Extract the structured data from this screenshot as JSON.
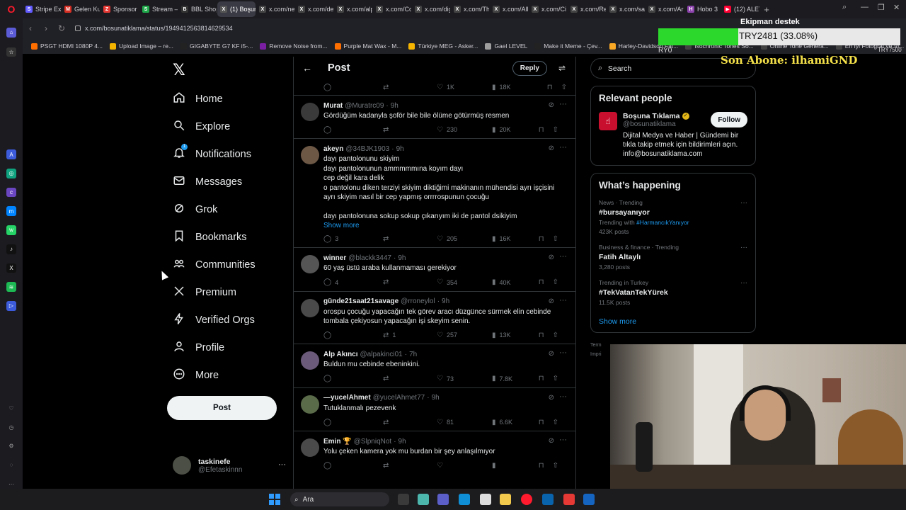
{
  "browser": {
    "tabs": [
      {
        "label": "Stripe Exp",
        "color": "#635bff",
        "glyph": "S"
      },
      {
        "label": "Gelen Kut",
        "color": "#d93025",
        "glyph": "M"
      },
      {
        "label": "Sponsor",
        "color": "#e53935",
        "glyph": "Z"
      },
      {
        "label": "Stream –",
        "color": "#20a94a",
        "glyph": "S"
      },
      {
        "label": "BBL Shop",
        "color": "#333333",
        "glyph": "B"
      },
      {
        "label": "(1) Boşuna Tıkla",
        "color": "#555555",
        "glyph": "X",
        "active": true
      },
      {
        "label": "x.com/ne",
        "color": "#444444",
        "glyph": "X"
      },
      {
        "label": "x.com/de",
        "color": "#444444",
        "glyph": "X"
      },
      {
        "label": "x.com/alp",
        "color": "#444444",
        "glyph": "X"
      },
      {
        "label": "x.com/Co",
        "color": "#444444",
        "glyph": "X"
      },
      {
        "label": "x.com/dig",
        "color": "#444444",
        "glyph": "X"
      },
      {
        "label": "x.com/Th",
        "color": "#444444",
        "glyph": "X"
      },
      {
        "label": "x.com/All",
        "color": "#444444",
        "glyph": "X"
      },
      {
        "label": "x.com/Ci",
        "color": "#444444",
        "glyph": "X"
      },
      {
        "label": "x.com/Re",
        "color": "#444444",
        "glyph": "X"
      },
      {
        "label": "x.com/sa",
        "color": "#444444",
        "glyph": "X"
      },
      {
        "label": "x.com/Ar",
        "color": "#444444",
        "glyph": "X"
      },
      {
        "label": "Hobo 3",
        "color": "#8e44ad",
        "glyph": "H"
      },
      {
        "label": "(12) ALET",
        "color": "#ff0033",
        "glyph": "▶"
      }
    ],
    "url": "x.com/bosunatiklama/status/1949412563814629534",
    "bookmarks": [
      {
        "label": "PSGT HDMI 1080P 4...",
        "color": "#ff6f00"
      },
      {
        "label": "Upload Image – re...",
        "color": "#f4b400"
      },
      {
        "label": "GIGABYTE G7 KF i5-...",
        "color": "#222222"
      },
      {
        "label": "Remove Noise from...",
        "color": "#7b1fa2"
      },
      {
        "label": "Purple Mat Wax - M...",
        "color": "#ff6f00"
      },
      {
        "label": "Türkiye MEG - Asker...",
        "color": "#f4b400"
      },
      {
        "label": "Gael LEVEL",
        "color": "#9e9e9e"
      },
      {
        "label": "Make it Meme - Çev...",
        "color": "#222222"
      },
      {
        "label": "Harley-Davidson Fat...",
        "color": "#f9a825"
      },
      {
        "label": "Isochronic Tones So...",
        "color": "#424242"
      },
      {
        "label": "Online Tone Genera...",
        "color": "#424242"
      },
      {
        "label": "En İyi Fotoğraf ve Vi...",
        "color": "#424242"
      }
    ]
  },
  "nav": {
    "items": [
      {
        "label": "Home",
        "icon": "home-icon"
      },
      {
        "label": "Explore",
        "icon": "search-icon"
      },
      {
        "label": "Notifications",
        "icon": "bell-icon",
        "badge": "1"
      },
      {
        "label": "Messages",
        "icon": "envelope-icon"
      },
      {
        "label": "Grok",
        "icon": "grok-icon"
      },
      {
        "label": "Bookmarks",
        "icon": "bookmark-icon"
      },
      {
        "label": "Communities",
        "icon": "communities-icon"
      },
      {
        "label": "Premium",
        "icon": "x-premium-icon"
      },
      {
        "label": "Verified Orgs",
        "icon": "lightning-icon"
      },
      {
        "label": "Profile",
        "icon": "person-icon"
      },
      {
        "label": "More",
        "icon": "more-circle-icon"
      }
    ],
    "post_label": "Post",
    "account": {
      "name": "taskinefe",
      "handle": "@Efetaskinnn"
    }
  },
  "feed": {
    "title": "Post",
    "reply_label": "Reply",
    "top_stats": {
      "replies": "",
      "reposts": "",
      "likes": "1K",
      "views": "18K"
    },
    "tweets": [
      {
        "name": "Murat",
        "handle": "@Muratrc09",
        "time": "9h",
        "avatar_color": "#3a3a3a",
        "lines": [
          "Gördüğüm kadanyla şoför bile bile ölüme götürmüş resmen"
        ],
        "replies": "",
        "reposts": "",
        "likes": "230",
        "views": "20K"
      },
      {
        "name": "akeyn",
        "handle": "@34BJK1903",
        "time": "9h",
        "avatar_color": "#6d5846",
        "lines": [
          "dayı pantolonunu skiyim",
          "dayı pantolonunun ammmmmına koyım dayı",
          "cep değil kara delik",
          "o pantolonu diken terziyi skiyim diktiğimi makinanın mühendisi ayrı işçisini",
          "ayrı skiyim nasıl bir cep yapmış orrrrospunun çocuğu",
          "",
          "dayı pantolonuna sokup sokup çıkarıyım iki de pantol dsikiyim"
        ],
        "show_more": "Show more",
        "replies": "3",
        "reposts": "",
        "likes": "205",
        "views": "16K"
      },
      {
        "name": "winner",
        "handle": "@blackk3447",
        "time": "9h",
        "avatar_color": "#555555",
        "lines": [
          "60 yaş üstü araba kullanmaması gerekiyor"
        ],
        "replies": "4",
        "reposts": "",
        "likes": "354",
        "views": "40K"
      },
      {
        "name": "günde21saat21savage",
        "handle": "@rroneylol",
        "time": "9h",
        "avatar_color": "#4a4a4a",
        "lines": [
          "orospu çocuğu yapacağın tek görev aracı düzgünce sürmek elin cebinde",
          "tombala çekiyosun yapacağın işi skeyim senin."
        ],
        "replies": "",
        "reposts": "1",
        "likes": "257",
        "views": "13K"
      },
      {
        "name": "Alp Akıncı",
        "handle": "@alpakinci01",
        "time": "7h",
        "avatar_color": "#6b5a7a",
        "lines": [
          "Buldun mu cebinde ebeninkini."
        ],
        "replies": "",
        "reposts": "",
        "likes": "73",
        "views": "7.8K"
      },
      {
        "name": "—yucelAhmet",
        "handle": "@yucelAhmet77",
        "time": "9h",
        "avatar_color": "#5a6b4a",
        "lines": [
          "Tutuklanmalı pezevenk"
        ],
        "replies": "",
        "reposts": "",
        "likes": "81",
        "views": "6.6K"
      },
      {
        "name": "Emin 🏆",
        "handle": "@SlpniqNot",
        "time": "9h",
        "avatar_color": "#4a4a4a",
        "lines": [
          "Yolu çeken kamera yok mu burdan bir şey anlaşılmıyor"
        ],
        "replies": "",
        "reposts": "",
        "likes": "",
        "views": ""
      }
    ]
  },
  "right": {
    "search_placeholder": "Search",
    "relevant_title": "Relevant people",
    "person": {
      "name": "Boşuna Tıklama",
      "handle": "@bosunatiklama",
      "follow_label": "Follow",
      "bio": [
        "Dijital Medya ve Haber | Gündemi bir",
        "tıkla takip etmek için bildirimleri açın.",
        "info@bosunatiklama.com"
      ]
    },
    "happening_title": "What’s happening",
    "trends": [
      {
        "meta": "News · Trending",
        "title": "#bursayanıyor",
        "sub_prefix": "Trending with ",
        "sub_link": "#HarmancıkYanıyor",
        "posts": "423K posts"
      },
      {
        "meta": "Business & finance · Trending",
        "title": "Fatih Altaylı",
        "sub_prefix": "",
        "sub_link": "",
        "posts": "3,280 posts"
      },
      {
        "meta": "Trending in Turkey",
        "title": "#TekVatanTekYürek",
        "sub_prefix": "",
        "sub_link": "",
        "posts": "11.5K posts"
      }
    ],
    "show_more": "Show more",
    "terms": "Term",
    "imprint": "Impri"
  },
  "overlay": {
    "support_label": "Ekipman destek",
    "goal_text": "TRY2481 (33.08%)",
    "goal_fraction": 0.3308,
    "range_min": "RY0",
    "range_max": "TRY7500",
    "last_sub": "Son Abone: ilhamiGND"
  },
  "taskbar": {
    "search_label": "Ara"
  }
}
